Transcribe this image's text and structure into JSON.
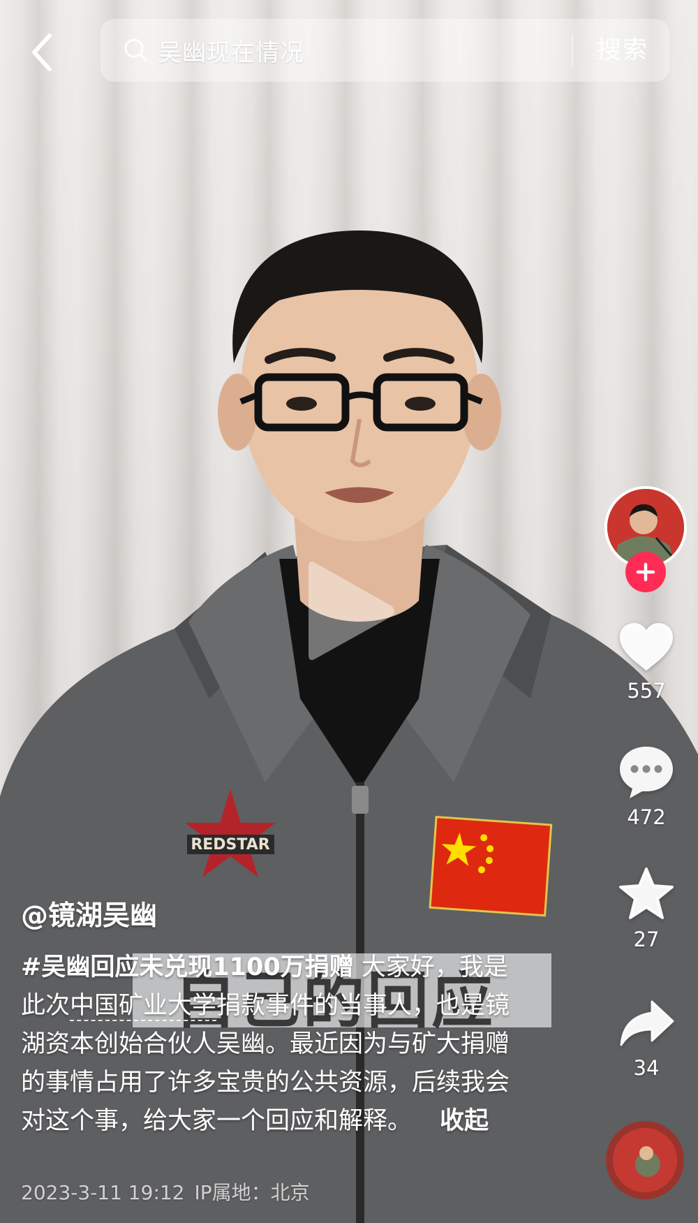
{
  "search": {
    "query": "吴幽现在情况",
    "button_label": "搜索"
  },
  "video": {
    "caption_overlay": "自己的回应"
  },
  "actions": {
    "likes": "557",
    "comments": "472",
    "favorites": "27",
    "shares": "34"
  },
  "post": {
    "author": "@镜湖吴幽",
    "hashtag": "#吴幽回应未兑现1100万捐赠",
    "text_part1": " 大家好，我是此次",
    "link": "中国矿业大学",
    "text_part2": "捐款事件的当事人，也是镜湖资本创始合伙人吴幽。最近因为与矿大捐赠的事情占用了许多宝贵的公共资源，后续我会对这个事，给大家一个回应和解释。",
    "collapse_label": "收起",
    "date": "2023-3-11 19:12",
    "ip_location": "IP属地：北京"
  },
  "colors": {
    "follow_red": "#fe2c55",
    "flag_red": "#de2910",
    "flag_yellow": "#ffde00"
  },
  "icons": [
    "back-arrow-icon",
    "search-icon",
    "play-icon",
    "plus-icon",
    "heart-icon",
    "comment-icon",
    "star-icon",
    "share-icon",
    "music-disc-icon"
  ]
}
